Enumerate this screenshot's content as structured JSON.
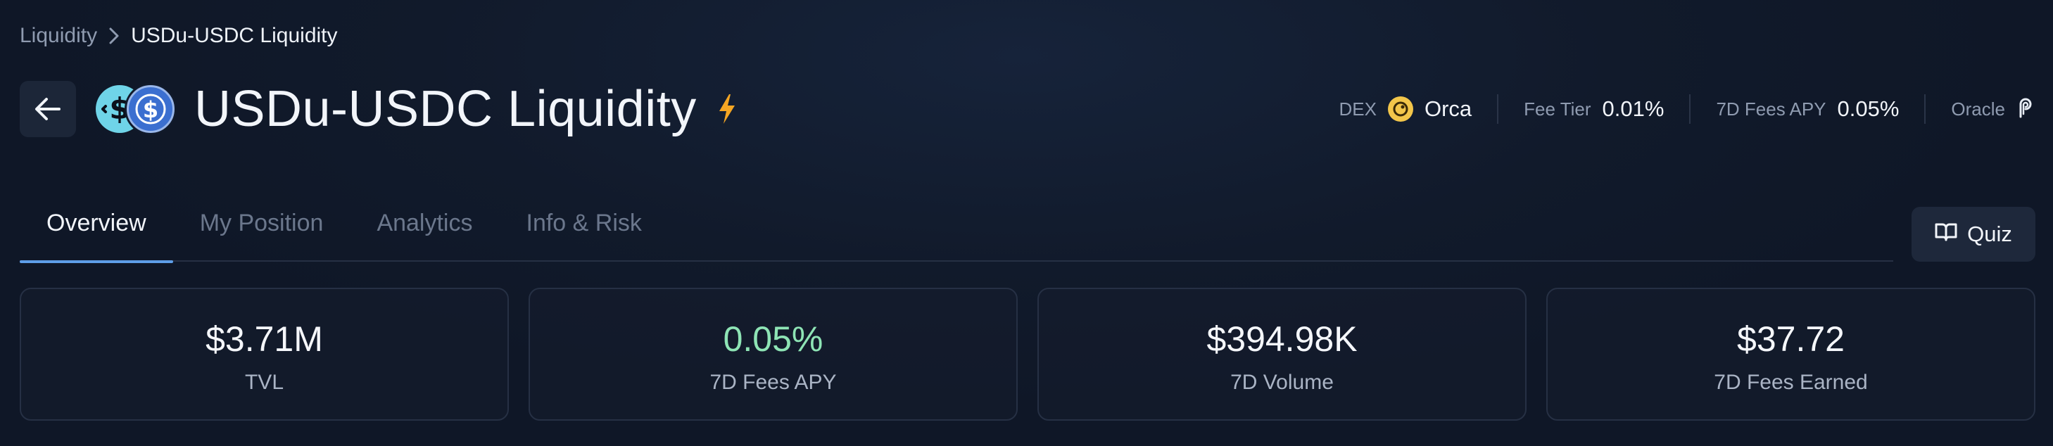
{
  "breadcrumb": {
    "parent": "Liquidity",
    "current": "USDu-USDC Liquidity"
  },
  "header": {
    "title": "USDu-USDC Liquidity",
    "tokens": [
      "USDu",
      "USDC"
    ]
  },
  "meta": {
    "dex_label": "DEX",
    "dex_value": "Orca",
    "fee_tier_label": "Fee Tier",
    "fee_tier_value": "0.01%",
    "fees_apy_label": "7D Fees APY",
    "fees_apy_value": "0.05%",
    "oracle_label": "Oracle"
  },
  "tabs": [
    {
      "label": "Overview",
      "active": true
    },
    {
      "label": "My Position",
      "active": false
    },
    {
      "label": "Analytics",
      "active": false
    },
    {
      "label": "Info & Risk",
      "active": false
    }
  ],
  "quiz_button": {
    "label": "Quiz"
  },
  "stats": [
    {
      "value": "$3.71M",
      "label": "TVL"
    },
    {
      "value": "0.05%",
      "label": "7D Fees APY"
    },
    {
      "value": "$394.98K",
      "label": "7D Volume"
    },
    {
      "value": "$37.72",
      "label": "7D Fees Earned"
    }
  ],
  "colors": {
    "background": "#111a2b",
    "accent_tab": "#5e9ee8",
    "positive": "#8ee4b5",
    "bolt": "#f5a623",
    "orca": "#f3c64a"
  },
  "icons": {
    "back": "arrow-left-icon",
    "chevron": "chevron-right-icon",
    "bolt": "lightning-bolt-icon",
    "orca": "orca-logo-icon",
    "oracle": "pyth-oracle-icon",
    "quiz": "book-open-icon"
  }
}
